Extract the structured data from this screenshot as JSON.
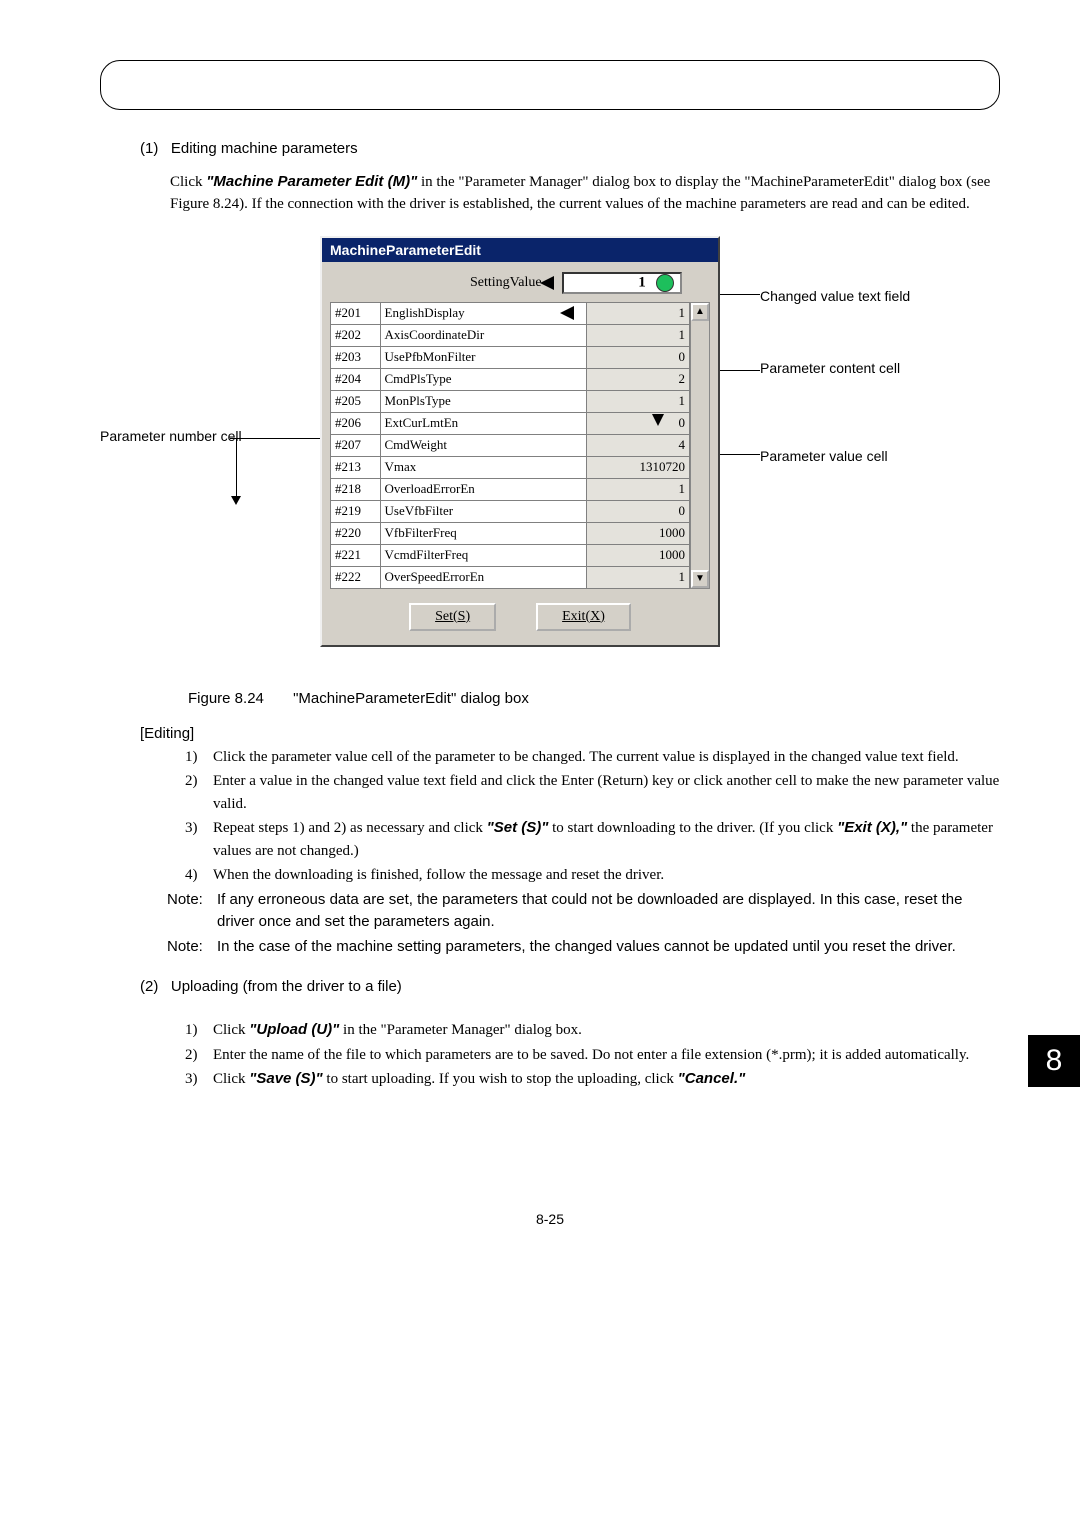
{
  "section1": {
    "num": "(1)",
    "title": "Editing machine parameters",
    "intro_parts": {
      "p1": "Click ",
      "cmd": "\"Machine Parameter Edit (M)\"",
      "p2": " in the \"Parameter Manager\" dialog box to display the \"MachineParameterEdit\" dialog box (see Figure 8.24). If the connection with the driver is established, the current values of the machine parameters are read and can be edited."
    }
  },
  "labels": {
    "param_num_cell": "Parameter number cell",
    "changed_value_text": "Changed value text field",
    "param_content_cell": "Parameter content cell",
    "param_value_cell": "Parameter value cell"
  },
  "dialog": {
    "title": "MachineParameterEdit",
    "setting_value": "SettingValue",
    "input_value": "1",
    "rows": [
      {
        "num": "#201",
        "name": "EnglishDisplay",
        "val": "1"
      },
      {
        "num": "#202",
        "name": "AxisCoordinateDir",
        "val": "1"
      },
      {
        "num": "#203",
        "name": "UsePfbMonFilter",
        "val": "0"
      },
      {
        "num": "#204",
        "name": "CmdPlsType",
        "val": "2"
      },
      {
        "num": "#205",
        "name": "MonPlsType",
        "val": "1"
      },
      {
        "num": "#206",
        "name": "ExtCurLmtEn",
        "val": "0"
      },
      {
        "num": "#207",
        "name": "CmdWeight",
        "val": "4"
      },
      {
        "num": "#213",
        "name": "Vmax",
        "val": "1310720"
      },
      {
        "num": "#218",
        "name": "OverloadErrorEn",
        "val": "1"
      },
      {
        "num": "#219",
        "name": "UseVfbFilter",
        "val": "0"
      },
      {
        "num": "#220",
        "name": "VfbFilterFreq",
        "val": "1000"
      },
      {
        "num": "#221",
        "name": "VcmdFilterFreq",
        "val": "1000"
      },
      {
        "num": "#222",
        "name": "OverSpeedErrorEn",
        "val": "1"
      }
    ],
    "set_btn": "Set(S)",
    "exit_btn": "Exit(X)"
  },
  "figure_caption": {
    "num": "Figure 8.24",
    "text": "\"MachineParameterEdit\" dialog box"
  },
  "editing": {
    "heading": "[Editing]",
    "items": [
      {
        "n": "1)",
        "t": "Click the parameter value cell of the parameter to be changed. The current value is displayed in the changed value text field."
      },
      {
        "n": "2)",
        "t": "Enter a value in the changed value text field and click the Enter (Return) key or click another cell to make the new parameter value valid."
      },
      {
        "n": "3)",
        "t_pre": "Repeat steps 1) and 2) as necessary and click ",
        "cmd1": "\"Set (S)\"",
        "t_mid": " to start downloading to the driver. (If you click ",
        "cmd2": "\"Exit (X),\"",
        "t_post": " the parameter values are not changed.)"
      },
      {
        "n": "4)",
        "t": "When the downloading is finished, follow the message and reset the driver."
      }
    ],
    "notes": [
      {
        "lbl": "Note:",
        "t": "If any erroneous data are set, the parameters that could not be downloaded are displayed. In this case, reset the driver once and set the parameters again."
      },
      {
        "lbl": "Note:",
        "t": "In the case of the machine setting parameters, the changed values cannot be updated until you reset the driver."
      }
    ]
  },
  "section2": {
    "num": "(2)",
    "title": "Uploading (from the driver to a file)",
    "items": [
      {
        "n": "1)",
        "t_pre": "Click ",
        "cmd": "\"Upload (U)\"",
        "t_post": " in the \"Parameter Manager\" dialog box."
      },
      {
        "n": "2)",
        "t": "Enter the name of the file to which parameters are to be saved. Do not enter a file extension (*.prm); it is added automatically."
      },
      {
        "n": "3)",
        "t_pre": "Click ",
        "cmd": "\"Save (S)\"",
        "t_mid": " to start uploading. If you wish to stop the uploading, click ",
        "cmd2": "\"Cancel.\""
      }
    ]
  },
  "page_tab": "8",
  "footer": "8-25"
}
